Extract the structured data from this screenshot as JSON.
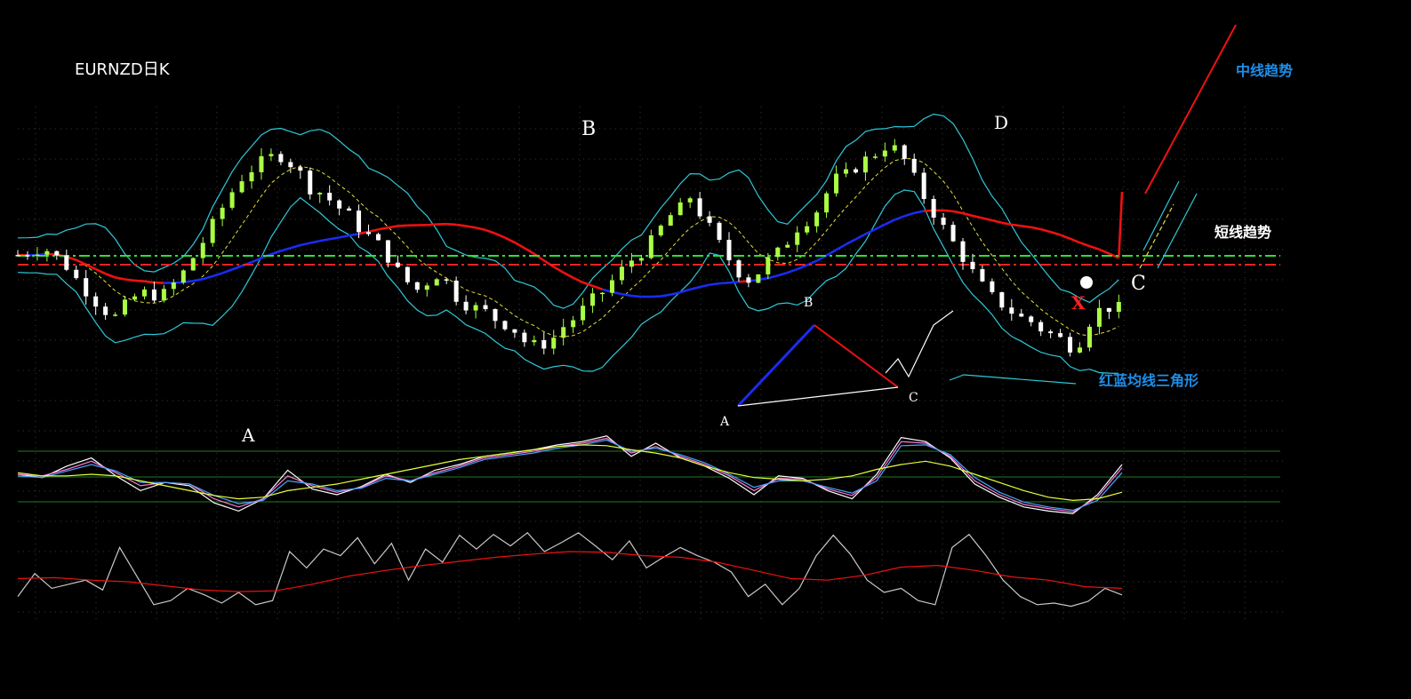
{
  "title": "EURNZD日K",
  "annotations": {
    "mid_trend": "中线趋势",
    "short_trend": "短线趋势",
    "triangle": "红蓝均线三角形",
    "point_a": "A",
    "point_b": "B",
    "point_c": "C",
    "point_d": "D",
    "point_x": "X",
    "tri_a": "A",
    "tri_b": "B",
    "tri_c": "C"
  },
  "colors": {
    "background": "#000000",
    "bull_candle": "#aaff44",
    "bear_candle": "#ffffff",
    "bollinger": "#2fc8d8",
    "mid_band": "#e8e03a",
    "ma_red": "#ee1111",
    "ma_blue": "#1a2cf0",
    "level_green": "#33dd33",
    "level_red": "#ee2222",
    "rsi_line": "#c8c8c8",
    "accent_blue": "#1e8ee8"
  },
  "chart_data": [
    {
      "type": "candlestick",
      "title": "EURNZD日K",
      "bollinger": true,
      "moving_average_colors": [
        "red",
        "blue"
      ],
      "horizontal_levels": [
        "green dash-dot",
        "red dash-dot"
      ],
      "close_path": [
        [
          0,
          0.55
        ],
        [
          8,
          0.58
        ],
        [
          14,
          0.52
        ],
        [
          20,
          0.42
        ],
        [
          26,
          0.33
        ],
        [
          30,
          0.3
        ],
        [
          34,
          0.36
        ],
        [
          38,
          0.4
        ],
        [
          44,
          0.38
        ],
        [
          50,
          0.46
        ],
        [
          56,
          0.58
        ],
        [
          62,
          0.72
        ],
        [
          68,
          0.85
        ],
        [
          74,
          0.92
        ],
        [
          80,
          0.96
        ],
        [
          86,
          0.9
        ],
        [
          90,
          0.82
        ],
        [
          94,
          0.8
        ],
        [
          97,
          0.76
        ],
        [
          100,
          0.73
        ],
        [
          103,
          0.7
        ],
        [
          106,
          0.64
        ],
        [
          109,
          0.62
        ],
        [
          112,
          0.58
        ],
        [
          116,
          0.5
        ],
        [
          120,
          0.44
        ],
        [
          124,
          0.4
        ],
        [
          128,
          0.48
        ],
        [
          132,
          0.44
        ],
        [
          136,
          0.36
        ],
        [
          140,
          0.34
        ],
        [
          144,
          0.32
        ],
        [
          148,
          0.28
        ],
        [
          152,
          0.26
        ],
        [
          156,
          0.2
        ],
        [
          160,
          0.18
        ],
        [
          164,
          0.2
        ],
        [
          168,
          0.26
        ],
        [
          172,
          0.3
        ],
        [
          176,
          0.36
        ],
        [
          180,
          0.4
        ],
        [
          184,
          0.46
        ],
        [
          188,
          0.52
        ],
        [
          192,
          0.56
        ],
        [
          196,
          0.62
        ],
        [
          200,
          0.7
        ],
        [
          204,
          0.74
        ],
        [
          208,
          0.8
        ],
        [
          210,
          0.72
        ],
        [
          214,
          0.64
        ],
        [
          218,
          0.55
        ],
        [
          222,
          0.48
        ],
        [
          226,
          0.44
        ],
        [
          230,
          0.52
        ],
        [
          234,
          0.56
        ],
        [
          238,
          0.62
        ],
        [
          240,
          0.66
        ],
        [
          242,
          0.7
        ],
        [
          244,
          0.68
        ],
        [
          248,
          0.78
        ],
        [
          252,
          0.86
        ],
        [
          256,
          0.88
        ],
        [
          260,
          0.93
        ],
        [
          264,
          0.96
        ],
        [
          268,
          1.0
        ],
        [
          272,
          0.96
        ],
        [
          276,
          0.86
        ],
        [
          280,
          0.76
        ],
        [
          284,
          0.68
        ],
        [
          288,
          0.6
        ],
        [
          292,
          0.52
        ],
        [
          296,
          0.44
        ],
        [
          300,
          0.38
        ],
        [
          304,
          0.34
        ],
        [
          308,
          0.3
        ],
        [
          312,
          0.28
        ],
        [
          316,
          0.24
        ],
        [
          320,
          0.22
        ],
        [
          324,
          0.18
        ],
        [
          326,
          0.16
        ],
        [
          328,
          0.24
        ],
        [
          330,
          0.28
        ],
        [
          332,
          0.32
        ],
        [
          335,
          0.34
        ],
        [
          338,
          0.33
        ],
        [
          340,
          0.34
        ]
      ]
    },
    {
      "type": "line",
      "indicator": "oscillator",
      "series": [
        {
          "color": "white",
          "values": [
            0.5,
            0.46,
            0.6,
            0.7,
            0.48,
            0.3,
            0.4,
            0.36,
            0.15,
            0.05,
            0.2,
            0.55,
            0.32,
            0.25,
            0.35,
            0.5,
            0.4,
            0.55,
            0.62,
            0.72,
            0.76,
            0.8,
            0.86,
            0.9,
            0.97,
            0.72,
            0.88,
            0.7,
            0.6,
            0.45,
            0.25,
            0.48,
            0.45,
            0.3,
            0.2,
            0.5,
            0.95,
            0.9,
            0.7,
            0.38,
            0.22,
            0.1,
            0.05,
            0.02,
            0.25,
            0.62
          ]
        },
        {
          "color": "pink",
          "values": [
            0.5,
            0.48,
            0.56,
            0.66,
            0.52,
            0.36,
            0.4,
            0.38,
            0.2,
            0.1,
            0.2,
            0.48,
            0.36,
            0.28,
            0.34,
            0.48,
            0.42,
            0.52,
            0.6,
            0.7,
            0.74,
            0.78,
            0.84,
            0.88,
            0.94,
            0.76,
            0.84,
            0.72,
            0.62,
            0.48,
            0.3,
            0.45,
            0.44,
            0.32,
            0.24,
            0.46,
            0.9,
            0.88,
            0.72,
            0.42,
            0.25,
            0.13,
            0.08,
            0.04,
            0.22,
            0.58
          ]
        },
        {
          "color": "blue",
          "values": [
            0.48,
            0.46,
            0.54,
            0.62,
            0.54,
            0.4,
            0.4,
            0.38,
            0.24,
            0.14,
            0.18,
            0.42,
            0.38,
            0.3,
            0.33,
            0.45,
            0.42,
            0.5,
            0.58,
            0.68,
            0.72,
            0.76,
            0.82,
            0.86,
            0.92,
            0.78,
            0.82,
            0.74,
            0.64,
            0.5,
            0.34,
            0.42,
            0.42,
            0.34,
            0.27,
            0.42,
            0.85,
            0.86,
            0.74,
            0.46,
            0.28,
            0.16,
            0.1,
            0.06,
            0.18,
            0.52
          ]
        },
        {
          "color": "yellow",
          "values": [
            0.52,
            0.48,
            0.48,
            0.5,
            0.48,
            0.42,
            0.36,
            0.3,
            0.24,
            0.2,
            0.22,
            0.3,
            0.34,
            0.38,
            0.44,
            0.5,
            0.56,
            0.62,
            0.68,
            0.72,
            0.76,
            0.8,
            0.84,
            0.86,
            0.85,
            0.8,
            0.76,
            0.7,
            0.6,
            0.52,
            0.46,
            0.44,
            0.42,
            0.44,
            0.48,
            0.56,
            0.62,
            0.66,
            0.6,
            0.5,
            0.4,
            0.3,
            0.22,
            0.18,
            0.2,
            0.28
          ]
        }
      ]
    },
    {
      "type": "line",
      "indicator": "momentum",
      "series": [
        {
          "color": "lightgray",
          "values": [
            0.2,
            0.48,
            0.3,
            0.35,
            0.4,
            0.28,
            0.8,
            0.45,
            0.1,
            0.15,
            0.3,
            0.22,
            0.12,
            0.25,
            0.1,
            0.15,
            0.75,
            0.55,
            0.78,
            0.7,
            0.92,
            0.6,
            0.85,
            0.4,
            0.78,
            0.62,
            0.95,
            0.78,
            0.96,
            0.82,
            0.98,
            0.75,
            0.86,
            0.98,
            0.82,
            0.65,
            0.88,
            0.55,
            0.68,
            0.8,
            0.7,
            0.62,
            0.5,
            0.2,
            0.35,
            0.1,
            0.3,
            0.7,
            0.95,
            0.72,
            0.4,
            0.25,
            0.3,
            0.15,
            0.1,
            0.8,
            0.96,
            0.7,
            0.4,
            0.2,
            0.1,
            0.12,
            0.08,
            0.14,
            0.3,
            0.22
          ]
        },
        {
          "color": "red",
          "values": [
            0.42,
            0.43,
            0.4,
            0.38,
            0.33,
            0.28,
            0.26,
            0.27,
            0.35,
            0.45,
            0.52,
            0.58,
            0.63,
            0.68,
            0.72,
            0.75,
            0.74,
            0.7,
            0.68,
            0.62,
            0.52,
            0.42,
            0.4,
            0.46,
            0.56,
            0.58,
            0.52,
            0.44,
            0.4,
            0.32,
            0.3
          ]
        }
      ]
    }
  ]
}
